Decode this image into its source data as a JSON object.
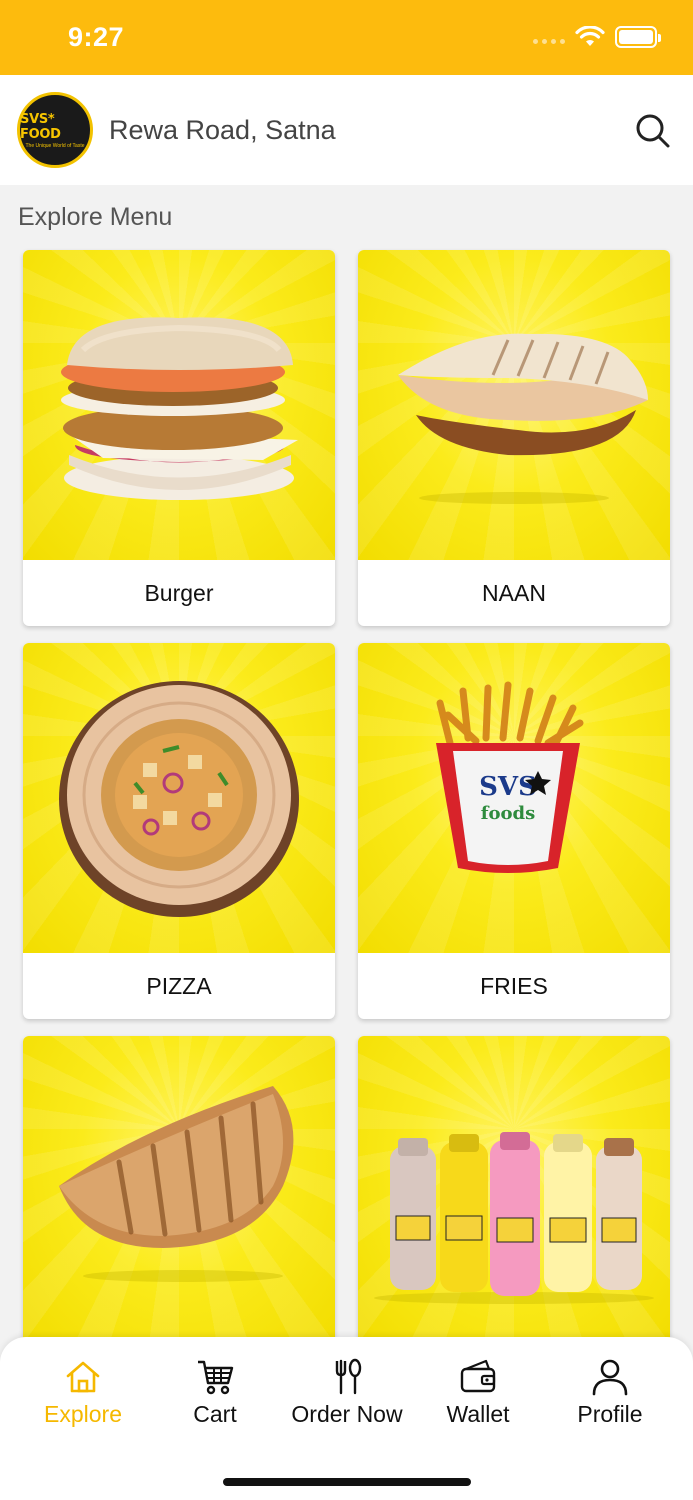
{
  "status_bar": {
    "time": "9:27"
  },
  "header": {
    "logo_text": "SVS* FOOD",
    "logo_tagline": "The Unique World of Taste",
    "location": "Rewa Road, Satna"
  },
  "section_title": "Explore Menu",
  "menu": [
    {
      "label": "Burger",
      "icon": "burger-image"
    },
    {
      "label": "NAAN",
      "icon": "naan-image"
    },
    {
      "label": "PIZZA",
      "icon": "pizza-image"
    },
    {
      "label": "FRIES",
      "icon": "fries-image"
    },
    {
      "label": "",
      "icon": "garlic-bread-image"
    },
    {
      "label": "",
      "icon": "shakes-image"
    }
  ],
  "bottom_nav": [
    {
      "label": "Explore",
      "icon": "home-icon",
      "active": true
    },
    {
      "label": "Cart",
      "icon": "cart-icon",
      "active": false
    },
    {
      "label": "Order Now",
      "icon": "fork-spoon-icon",
      "active": false
    },
    {
      "label": "Wallet",
      "icon": "wallet-icon",
      "active": false
    },
    {
      "label": "Profile",
      "icon": "person-icon",
      "active": false
    }
  ],
  "colors": {
    "accent": "#fdbb0d",
    "active_nav": "#f5b800",
    "card_bg": "#fbeb1b"
  }
}
